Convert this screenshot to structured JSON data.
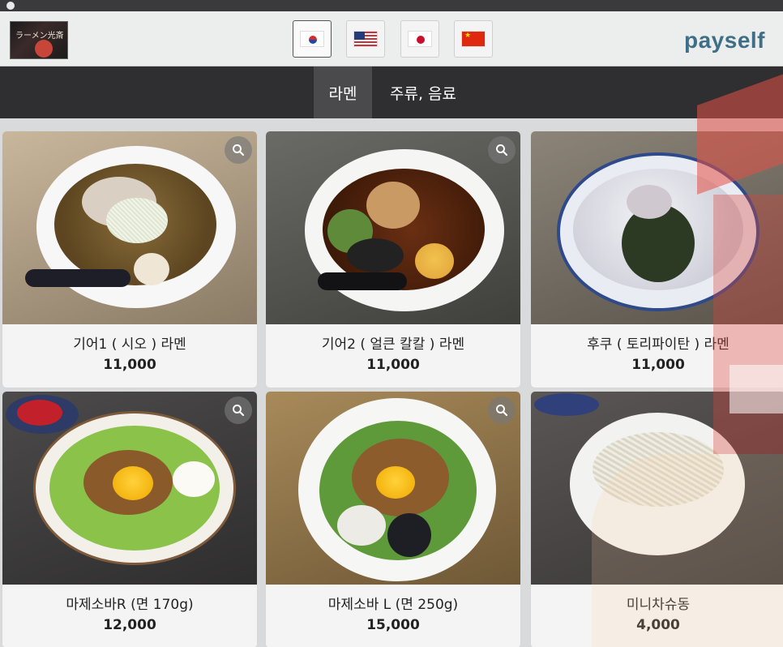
{
  "header": {
    "store_logo_text": "ラーメン光斎",
    "brand": "payself",
    "languages": [
      {
        "code": "ko",
        "icon": "korea-flag-icon",
        "active": true
      },
      {
        "code": "en",
        "icon": "usa-flag-icon",
        "active": false
      },
      {
        "code": "ja",
        "icon": "japan-flag-icon",
        "active": false
      },
      {
        "code": "zh",
        "icon": "china-flag-icon",
        "active": false
      }
    ]
  },
  "categories": [
    {
      "label": "라멘",
      "active": true
    },
    {
      "label": "주류, 음료",
      "active": false
    }
  ],
  "menu": [
    {
      "name": "기어1 ( 시오 ) 라멘",
      "price": "11,000"
    },
    {
      "name": "기어2 ( 얼큰 칼칼 ) 라멘",
      "price": "11,000"
    },
    {
      "name": "후쿠 ( 토리파이탄 ) 라멘",
      "price": "11,000"
    },
    {
      "name": "마제소바R (면 170g)",
      "price": "12,000"
    },
    {
      "name": "마제소바 L (면 250g)",
      "price": "15,000"
    },
    {
      "name": "미니차슈동",
      "price": "4,000"
    }
  ],
  "colors": {
    "category_bar": "#2f2f31",
    "category_active": "#4a4a4c",
    "brand": "#3e6f86"
  }
}
